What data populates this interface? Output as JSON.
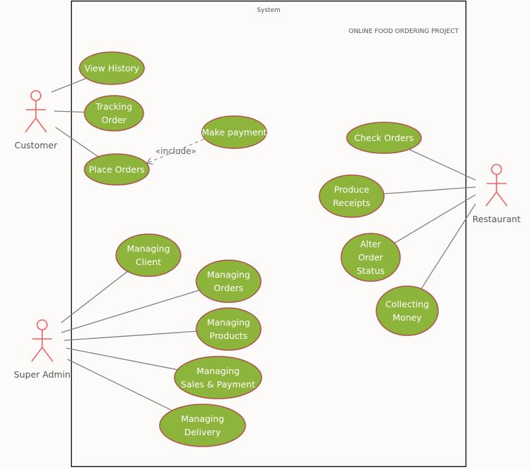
{
  "system": {
    "label": "System",
    "project_title": "ONLINE FOOD ORDERING PROJECT"
  },
  "colors": {
    "usecase_fill": "#8db53c",
    "usecase_stroke": "#b0504a",
    "actor_stroke": "#f06161",
    "association_line": "#808080",
    "boundary": "#000000",
    "background": "#fcfbfa"
  },
  "actors": [
    {
      "id": "customer",
      "label": "Customer"
    },
    {
      "id": "restaurant",
      "label": "Restaurant"
    },
    {
      "id": "super_admin",
      "label": "Super Admin"
    }
  ],
  "use_cases": [
    {
      "id": "view_history",
      "lines": [
        "View History"
      ]
    },
    {
      "id": "tracking_order",
      "lines": [
        "Tracking",
        "Order"
      ]
    },
    {
      "id": "place_orders",
      "lines": [
        "Place Orders"
      ]
    },
    {
      "id": "make_payment",
      "lines": [
        "Make payment"
      ]
    },
    {
      "id": "check_orders",
      "lines": [
        "Check Orders"
      ]
    },
    {
      "id": "produce_receipts",
      "lines": [
        "Produce",
        "Receipts"
      ]
    },
    {
      "id": "alter_order_status",
      "lines": [
        "Alter",
        "Order",
        "Status"
      ]
    },
    {
      "id": "collecting_money",
      "lines": [
        "Collecting",
        "Money"
      ]
    },
    {
      "id": "managing_client",
      "lines": [
        "Managing",
        "Client"
      ]
    },
    {
      "id": "managing_orders",
      "lines": [
        "Managing",
        "Orders"
      ]
    },
    {
      "id": "managing_products",
      "lines": [
        "Managing",
        "Products"
      ]
    },
    {
      "id": "managing_sales_payment",
      "lines": [
        "Managing",
        "Sales & Payment"
      ]
    },
    {
      "id": "managing_delivery",
      "lines": [
        "Managing",
        "Delivery"
      ]
    }
  ],
  "associations": [
    {
      "actor": "customer",
      "use_case": "view_history"
    },
    {
      "actor": "customer",
      "use_case": "tracking_order"
    },
    {
      "actor": "customer",
      "use_case": "place_orders"
    },
    {
      "actor": "restaurant",
      "use_case": "check_orders"
    },
    {
      "actor": "restaurant",
      "use_case": "produce_receipts"
    },
    {
      "actor": "restaurant",
      "use_case": "alter_order_status"
    },
    {
      "actor": "restaurant",
      "use_case": "collecting_money"
    },
    {
      "actor": "super_admin",
      "use_case": "managing_client"
    },
    {
      "actor": "super_admin",
      "use_case": "managing_orders"
    },
    {
      "actor": "super_admin",
      "use_case": "managing_products"
    },
    {
      "actor": "super_admin",
      "use_case": "managing_sales_payment"
    },
    {
      "actor": "super_admin",
      "use_case": "managing_delivery"
    }
  ],
  "relationships": [
    {
      "type": "include",
      "from": "place_orders",
      "to": "make_payment",
      "label": "«include»"
    }
  ]
}
